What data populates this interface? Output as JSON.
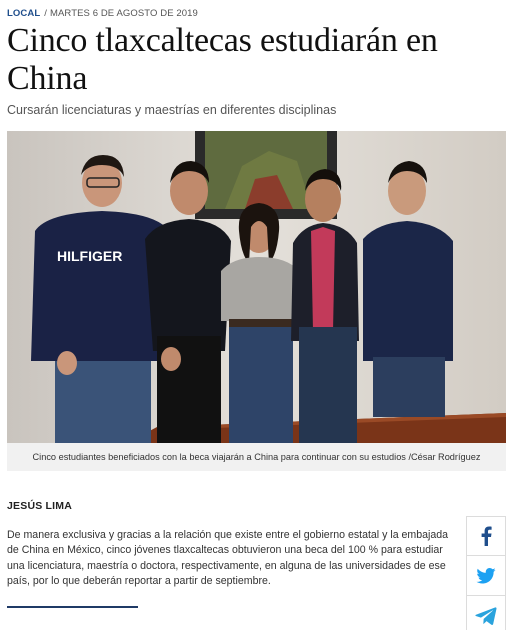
{
  "meta": {
    "section": "LOCAL",
    "separator": "/",
    "date": "MARTES 6 DE AGOSTO DE 2019"
  },
  "article": {
    "headline": "Cinco tlaxcaltecas estudiarán en China",
    "subtitle": "Cursarán licenciaturas y maestrías en diferentes disciplinas",
    "photo": {
      "sweater_text": "HILFIGER"
    },
    "caption": "Cinco estudiantes beneficiados con la beca viajarán a China para continuar con su estudios /César Rodríguez",
    "author": "JESÚS LIMA",
    "body": "De manera exclusiva y gracias a la relación que existe entre el gobierno estatal y la embajada de China en México, cinco jóvenes tlaxcaltecas obtuvieron una beca del 100 % para estudiar una licenciatura, maestría o doctora, respectivamente, en alguna de las universidades de ese país, por lo que deberán reportar a partir de septiembre."
  },
  "share": {
    "items": [
      {
        "icon": "facebook-icon",
        "color": "#1f4e8c"
      },
      {
        "icon": "twitter-icon",
        "color": "#1da1f2"
      },
      {
        "icon": "telegram-icon",
        "color": "#2aa3dd"
      }
    ]
  },
  "colors": {
    "accent": "#1f4e8c",
    "rule": "#1f3a66",
    "caption_bg": "#f1f1f1"
  }
}
